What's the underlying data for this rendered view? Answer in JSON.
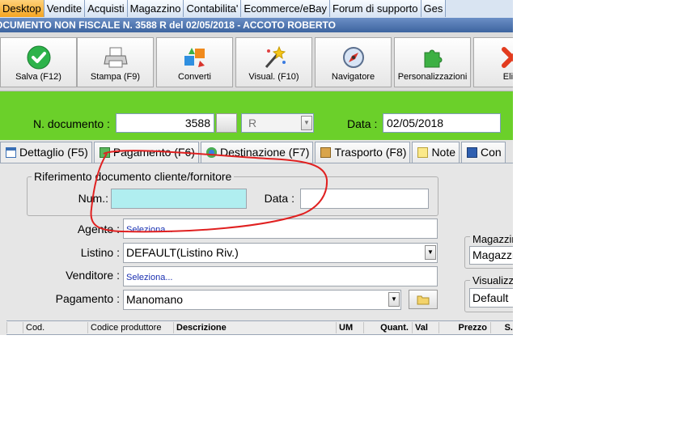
{
  "menu": [
    "Desktop",
    "Vendite",
    "Acquisti",
    "Magazzino",
    "Contabilita'",
    "Ecommerce/eBay",
    "Forum di supporto",
    "Ges"
  ],
  "title": "OCUMENTO NON FISCALE N. 3588 R del 02/05/2018 - ACCOTO ROBERTO",
  "toolbar": [
    {
      "label": "Salva (F12)",
      "icon": "check-icon"
    },
    {
      "label": "Stampa (F9)",
      "icon": "printer-icon"
    },
    {
      "label": "Converti",
      "icon": "convert-icon"
    },
    {
      "label": "Visual. (F10)",
      "icon": "magic-wand-icon"
    },
    {
      "label": "Navigatore",
      "icon": "compass-icon"
    },
    {
      "label": "Personalizzazioni",
      "icon": "puzzle-icon"
    },
    {
      "label": "Elim",
      "icon": "delete-icon"
    }
  ],
  "header": {
    "doc_label": "N. documento :",
    "doc_number": "3588",
    "series": "R",
    "date_label": "Data :",
    "date": "02/05/2018"
  },
  "tabs": [
    {
      "label": "Dettaglio (F5)",
      "icon": "table-icon"
    },
    {
      "label": "Pagamento (F6)",
      "icon": "money-icon"
    },
    {
      "label": "Destinazione (F7)",
      "icon": "destination-icon"
    },
    {
      "label": "Trasporto (F8)",
      "icon": "package-icon"
    },
    {
      "label": "Note",
      "icon": "note-icon"
    },
    {
      "label": "Con",
      "icon": "contract-icon"
    }
  ],
  "reference": {
    "group_title": "Riferimento documento cliente/fornitore",
    "num_label": "Num.:",
    "num_value": "",
    "data_label": "Data :",
    "data_value": ""
  },
  "form": {
    "agente_label": "Agente :",
    "agente_value": "Seleziona...",
    "listino_label": "Listino :",
    "listino_value": "DEFAULT(Listino Riv.)",
    "venditore_label": "Venditore :",
    "venditore_value": "Seleziona...",
    "pagamento_label": "Pagamento :",
    "pagamento_value": "Manomano"
  },
  "right": {
    "magazzino_title": "Magazzin",
    "magazzino_value": "Magazzin",
    "visualizza_title": "Visualizza",
    "visualizza_value": "Default"
  },
  "grid_columns": [
    "Cod.",
    "Codice produttore",
    "Descrizione",
    "UM",
    "Quant.",
    "Val",
    "Prezzo",
    "S."
  ],
  "colors": {
    "green_band": "#6bd02a",
    "title_bar": "#3d649f",
    "active_tab": "#f4a522",
    "num_highlight": "#b0eef0",
    "annotation": "#e02020"
  }
}
